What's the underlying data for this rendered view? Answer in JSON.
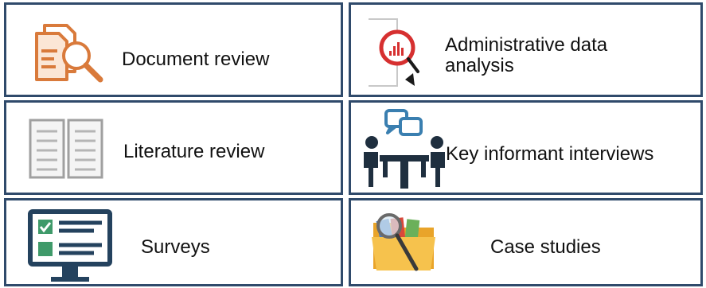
{
  "colors": {
    "border": "#2f4a6b",
    "document_icon": "#d97a3b",
    "chart_icon": "#d63030",
    "people_icon": "#1f2f3f",
    "chat_icon": "#3a7fb0",
    "screen_icon": "#24425e",
    "check_green": "#3f9a6a",
    "folder_icon": "#f2b23a"
  },
  "items": [
    {
      "label": "Document review",
      "icon": "document-search-icon"
    },
    {
      "label": "Administrative data\nanalysis",
      "icon": "chart-magnifier-icon"
    },
    {
      "label": "Literature review",
      "icon": "open-book-icon"
    },
    {
      "label": "Key informant interviews",
      "icon": "interview-people-icon"
    },
    {
      "label": "Surveys",
      "icon": "survey-screen-icon"
    },
    {
      "label": "Case studies",
      "icon": "folder-magnifier-icon"
    }
  ]
}
